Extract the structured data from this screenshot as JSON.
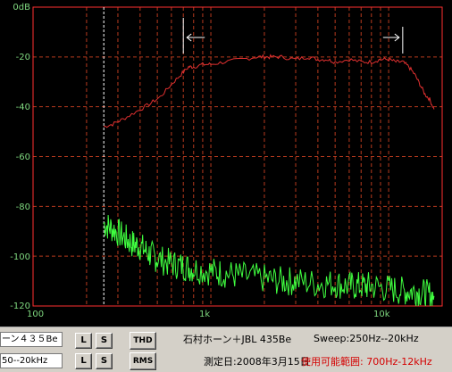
{
  "chart_data": {
    "type": "line",
    "x_scale": "log",
    "xlim": [
      100,
      20000
    ],
    "ylim": [
      -120,
      0
    ],
    "y_unit": "dB",
    "grid": true,
    "ytick_labels": [
      "0dB",
      "-20",
      "-40",
      "-60",
      "-80",
      "-100",
      "-120"
    ],
    "ytick_values": [
      0,
      -20,
      -40,
      -60,
      -80,
      -100,
      -120
    ],
    "xtick_labels": [
      "100",
      "1k",
      "10k"
    ],
    "xtick_values": [
      100,
      1000,
      10000
    ],
    "marker_line_x": 250,
    "range_markers": [
      700,
      12000
    ],
    "series": [
      {
        "color": "#e03030",
        "role": "response",
        "x": [
          250,
          280,
          320,
          380,
          450,
          520,
          600,
          680,
          750,
          800,
          900,
          1000,
          1200,
          1500,
          1800,
          2000,
          2200,
          2500,
          3000,
          3500,
          4000,
          4500,
          5000,
          6000,
          7000,
          8000,
          9000,
          10000,
          11000,
          12000,
          13000,
          14000,
          15000,
          16000,
          17000,
          18000
        ],
        "y": [
          -48,
          -47,
          -45,
          -42,
          -39,
          -36,
          -31,
          -27,
          -24,
          -24,
          -23,
          -23,
          -22,
          -21,
          -20,
          -20,
          -20,
          -20,
          -21,
          -20,
          -21,
          -21,
          -22,
          -21,
          -22,
          -22,
          -21,
          -21,
          -22,
          -22,
          -24,
          -27,
          -31,
          -35,
          -37,
          -41
        ]
      },
      {
        "color": "#40ff40",
        "role": "distortion",
        "x": [
          250,
          280,
          320,
          360,
          400,
          450,
          500,
          600,
          700,
          800,
          1000,
          1200,
          1500,
          2000,
          2500,
          3000,
          4000,
          5000,
          6000,
          7000,
          8000,
          10000,
          12000,
          14000,
          16000,
          18000
        ],
        "y": [
          -87,
          -89,
          -92,
          -95,
          -96,
          -99,
          -101,
          -103,
          -104,
          -105,
          -106,
          -107,
          -108,
          -109,
          -110,
          -110,
          -111,
          -111,
          -112,
          -112,
          -112,
          -113,
          -114,
          -114,
          -115,
          -116
        ]
      }
    ]
  },
  "colors": {
    "background": "#000000",
    "frame": "#ff3030",
    "grid": "#b83a1e",
    "axis_text": "#7fd87f",
    "response": "#e03030",
    "distortion": "#40ff40",
    "marker": "#ffffff"
  },
  "controls": {
    "model_field": "ーン４３５Be",
    "range_field": "50--20kHz",
    "btn_l": "L",
    "btn_s": "S",
    "btn_thd": "THD",
    "btn_rms": "RMS",
    "title": "石村ホーン＋JBL 435Be",
    "sweep": "Sweep:250Hz--20kHz",
    "date": "測定日:2008年3月15日",
    "usable_range": "使用可能範囲: 700Hz-12kHz"
  },
  "icons": {
    "left_arrow": "arrow-left-icon",
    "right_arrow": "arrow-right-icon"
  }
}
